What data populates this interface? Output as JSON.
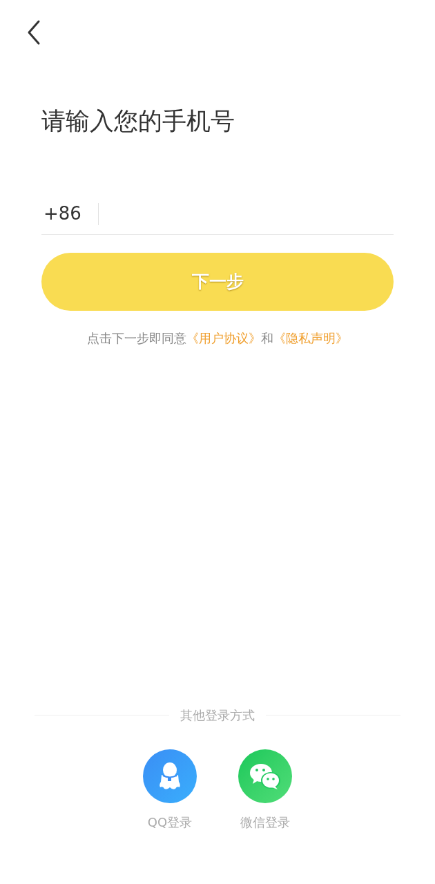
{
  "title": "请输入您的手机号",
  "phone": {
    "country_code": "+86"
  },
  "next_button": {
    "label": "下一步",
    "disabled": true
  },
  "terms": {
    "prefix": "点击下一步即同意",
    "links": [
      "《用户协议》",
      "《隐私声明》"
    ],
    "joiner": "和"
  },
  "other_login": {
    "heading": "其他登录方式",
    "options": [
      {
        "kind": "qq",
        "label": "QQ登录"
      },
      {
        "kind": "wechat",
        "label": "微信登录"
      }
    ]
  }
}
